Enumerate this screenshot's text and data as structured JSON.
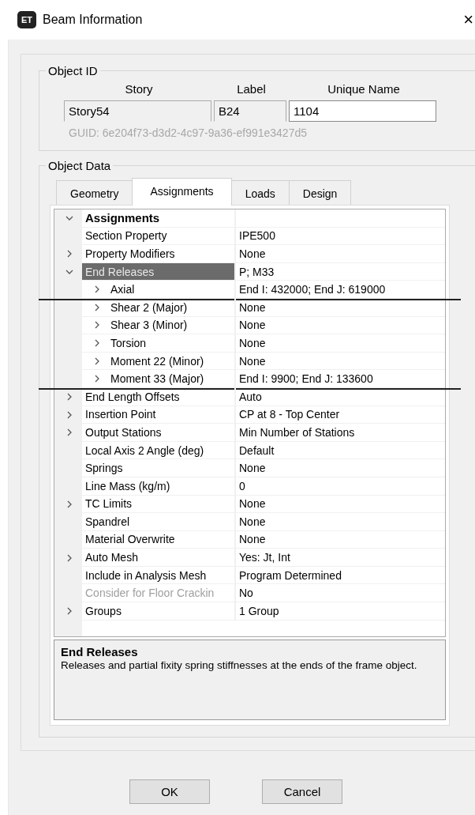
{
  "window": {
    "icon_text": "ET",
    "title": "Beam Information",
    "close": "×"
  },
  "object_id": {
    "legend": "Object ID",
    "columns": [
      "Story",
      "Label",
      "Unique Name"
    ],
    "fields": [
      {
        "value": "Story54",
        "disabled": true
      },
      {
        "value": "B24",
        "disabled": true
      },
      {
        "value": "1104",
        "disabled": false
      }
    ],
    "guid": "GUID:  6e204f73-d3d2-4c97-9a36-ef991e3427d5"
  },
  "object_data": {
    "legend": "Object Data",
    "tabs": [
      {
        "label": "Geometry",
        "selected": false
      },
      {
        "label": "Assignments",
        "selected": true
      },
      {
        "label": "Loads",
        "selected": false
      },
      {
        "label": "Design",
        "selected": false
      }
    ],
    "tree": [
      {
        "name": "Assignments",
        "expanded": true,
        "selected": false,
        "children": [
          {
            "name": "Section Property",
            "value": "IPE500",
            "selected": false
          },
          {
            "name": "Property Modifiers",
            "value": "None",
            "expanded": false,
            "selected": false
          },
          {
            "name": "End Releases",
            "value": "P; M33",
            "expanded": true,
            "selected": true,
            "children": [
              {
                "name": "Axial",
                "value": "End I: 432000; End J: 619000",
                "expanded": false,
                "selected": false,
                "underlined": true
              },
              {
                "name": "Shear 2 (Major)",
                "value": "None",
                "expanded": false,
                "selected": false,
                "underlined": false
              },
              {
                "name": "Shear 3 (Minor)",
                "value": "None",
                "expanded": false,
                "selected": false,
                "underlined": false
              },
              {
                "name": "Torsion",
                "value": "None",
                "expanded": false,
                "selected": false,
                "underlined": false
              },
              {
                "name": "Moment 22 (Minor)",
                "value": "None",
                "expanded": false,
                "selected": false,
                "underlined": false
              },
              {
                "name": "Moment 33 (Major)",
                "value": "End I: 9900; End J: 133600",
                "expanded": false,
                "selected": false,
                "underlined": true
              }
            ]
          },
          {
            "name": "End Length Offsets",
            "value": "Auto",
            "expanded": false,
            "selected": false
          },
          {
            "name": "Insertion Point",
            "value": "CP at 8 - Top Center",
            "expanded": false,
            "selected": false
          },
          {
            "name": "Output Stations",
            "value": "Min Number of Stations",
            "expanded": false,
            "selected": false
          },
          {
            "name": "Local Axis 2 Angle (deg)",
            "value": "Default",
            "selected": false
          },
          {
            "name": "Springs",
            "value": "None",
            "selected": false
          },
          {
            "name": "Line Mass (kg/m)",
            "value": "0",
            "selected": false
          },
          {
            "name": "TC Limits",
            "value": "None",
            "expanded": false,
            "selected": false
          },
          {
            "name": "Spandrel",
            "value": "None",
            "selected": false
          },
          {
            "name": "Material Overwrite",
            "value": "None",
            "selected": false
          },
          {
            "name": "Auto Mesh",
            "value": "Yes: Jt, Int",
            "expanded": false,
            "selected": false
          },
          {
            "name": "Include in Analysis Mesh",
            "value": "Program Determined",
            "selected": false
          },
          {
            "name": "Consider for Floor Crackin",
            "value": "No",
            "selected": false,
            "disabled": true
          },
          {
            "name": "Groups",
            "value": "1 Group",
            "expanded": false,
            "selected": false
          }
        ]
      }
    ],
    "description": {
      "title": "End Releases",
      "text": "Releases and partial fixity spring stiffnesses at the ends of the frame object."
    }
  },
  "buttons": [
    "OK",
    "Cancel"
  ]
}
